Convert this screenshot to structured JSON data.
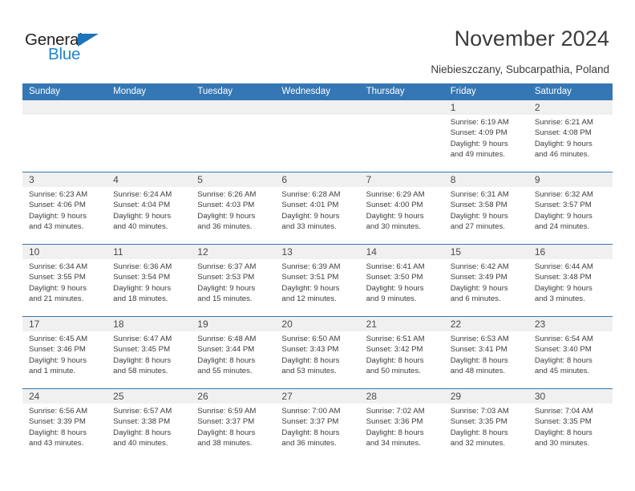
{
  "brand": {
    "name_part1": "General",
    "name_part2": "Blue",
    "accent_color": "#2387cd",
    "triangle_color": "#1e74bb"
  },
  "header": {
    "title": "November 2024",
    "subtitle": "Niebieszczany, Subcarpathia, Poland"
  },
  "theme": {
    "header_row_bg": "#3577b5",
    "date_band_bg": "#f0f0f0",
    "grid_line": "#3577b5"
  },
  "calendar": {
    "weekday_headers": [
      "Sunday",
      "Monday",
      "Tuesday",
      "Wednesday",
      "Thursday",
      "Friday",
      "Saturday"
    ],
    "weeks": [
      [
        {
          "day": "",
          "lines": []
        },
        {
          "day": "",
          "lines": []
        },
        {
          "day": "",
          "lines": []
        },
        {
          "day": "",
          "lines": []
        },
        {
          "day": "",
          "lines": []
        },
        {
          "day": "1",
          "lines": [
            "Sunrise: 6:19 AM",
            "Sunset: 4:09 PM",
            "Daylight: 9 hours",
            "and 49 minutes."
          ]
        },
        {
          "day": "2",
          "lines": [
            "Sunrise: 6:21 AM",
            "Sunset: 4:08 PM",
            "Daylight: 9 hours",
            "and 46 minutes."
          ]
        }
      ],
      [
        {
          "day": "3",
          "lines": [
            "Sunrise: 6:23 AM",
            "Sunset: 4:06 PM",
            "Daylight: 9 hours",
            "and 43 minutes."
          ]
        },
        {
          "day": "4",
          "lines": [
            "Sunrise: 6:24 AM",
            "Sunset: 4:04 PM",
            "Daylight: 9 hours",
            "and 40 minutes."
          ]
        },
        {
          "day": "5",
          "lines": [
            "Sunrise: 6:26 AM",
            "Sunset: 4:03 PM",
            "Daylight: 9 hours",
            "and 36 minutes."
          ]
        },
        {
          "day": "6",
          "lines": [
            "Sunrise: 6:28 AM",
            "Sunset: 4:01 PM",
            "Daylight: 9 hours",
            "and 33 minutes."
          ]
        },
        {
          "day": "7",
          "lines": [
            "Sunrise: 6:29 AM",
            "Sunset: 4:00 PM",
            "Daylight: 9 hours",
            "and 30 minutes."
          ]
        },
        {
          "day": "8",
          "lines": [
            "Sunrise: 6:31 AM",
            "Sunset: 3:58 PM",
            "Daylight: 9 hours",
            "and 27 minutes."
          ]
        },
        {
          "day": "9",
          "lines": [
            "Sunrise: 6:32 AM",
            "Sunset: 3:57 PM",
            "Daylight: 9 hours",
            "and 24 minutes."
          ]
        }
      ],
      [
        {
          "day": "10",
          "lines": [
            "Sunrise: 6:34 AM",
            "Sunset: 3:55 PM",
            "Daylight: 9 hours",
            "and 21 minutes."
          ]
        },
        {
          "day": "11",
          "lines": [
            "Sunrise: 6:36 AM",
            "Sunset: 3:54 PM",
            "Daylight: 9 hours",
            "and 18 minutes."
          ]
        },
        {
          "day": "12",
          "lines": [
            "Sunrise: 6:37 AM",
            "Sunset: 3:53 PM",
            "Daylight: 9 hours",
            "and 15 minutes."
          ]
        },
        {
          "day": "13",
          "lines": [
            "Sunrise: 6:39 AM",
            "Sunset: 3:51 PM",
            "Daylight: 9 hours",
            "and 12 minutes."
          ]
        },
        {
          "day": "14",
          "lines": [
            "Sunrise: 6:41 AM",
            "Sunset: 3:50 PM",
            "Daylight: 9 hours",
            "and 9 minutes."
          ]
        },
        {
          "day": "15",
          "lines": [
            "Sunrise: 6:42 AM",
            "Sunset: 3:49 PM",
            "Daylight: 9 hours",
            "and 6 minutes."
          ]
        },
        {
          "day": "16",
          "lines": [
            "Sunrise: 6:44 AM",
            "Sunset: 3:48 PM",
            "Daylight: 9 hours",
            "and 3 minutes."
          ]
        }
      ],
      [
        {
          "day": "17",
          "lines": [
            "Sunrise: 6:45 AM",
            "Sunset: 3:46 PM",
            "Daylight: 9 hours",
            "and 1 minute."
          ]
        },
        {
          "day": "18",
          "lines": [
            "Sunrise: 6:47 AM",
            "Sunset: 3:45 PM",
            "Daylight: 8 hours",
            "and 58 minutes."
          ]
        },
        {
          "day": "19",
          "lines": [
            "Sunrise: 6:48 AM",
            "Sunset: 3:44 PM",
            "Daylight: 8 hours",
            "and 55 minutes."
          ]
        },
        {
          "day": "20",
          "lines": [
            "Sunrise: 6:50 AM",
            "Sunset: 3:43 PM",
            "Daylight: 8 hours",
            "and 53 minutes."
          ]
        },
        {
          "day": "21",
          "lines": [
            "Sunrise: 6:51 AM",
            "Sunset: 3:42 PM",
            "Daylight: 8 hours",
            "and 50 minutes."
          ]
        },
        {
          "day": "22",
          "lines": [
            "Sunrise: 6:53 AM",
            "Sunset: 3:41 PM",
            "Daylight: 8 hours",
            "and 48 minutes."
          ]
        },
        {
          "day": "23",
          "lines": [
            "Sunrise: 6:54 AM",
            "Sunset: 3:40 PM",
            "Daylight: 8 hours",
            "and 45 minutes."
          ]
        }
      ],
      [
        {
          "day": "24",
          "lines": [
            "Sunrise: 6:56 AM",
            "Sunset: 3:39 PM",
            "Daylight: 8 hours",
            "and 43 minutes."
          ]
        },
        {
          "day": "25",
          "lines": [
            "Sunrise: 6:57 AM",
            "Sunset: 3:38 PM",
            "Daylight: 8 hours",
            "and 40 minutes."
          ]
        },
        {
          "day": "26",
          "lines": [
            "Sunrise: 6:59 AM",
            "Sunset: 3:37 PM",
            "Daylight: 8 hours",
            "and 38 minutes."
          ]
        },
        {
          "day": "27",
          "lines": [
            "Sunrise: 7:00 AM",
            "Sunset: 3:37 PM",
            "Daylight: 8 hours",
            "and 36 minutes."
          ]
        },
        {
          "day": "28",
          "lines": [
            "Sunrise: 7:02 AM",
            "Sunset: 3:36 PM",
            "Daylight: 8 hours",
            "and 34 minutes."
          ]
        },
        {
          "day": "29",
          "lines": [
            "Sunrise: 7:03 AM",
            "Sunset: 3:35 PM",
            "Daylight: 8 hours",
            "and 32 minutes."
          ]
        },
        {
          "day": "30",
          "lines": [
            "Sunrise: 7:04 AM",
            "Sunset: 3:35 PM",
            "Daylight: 8 hours",
            "and 30 minutes."
          ]
        }
      ]
    ]
  }
}
